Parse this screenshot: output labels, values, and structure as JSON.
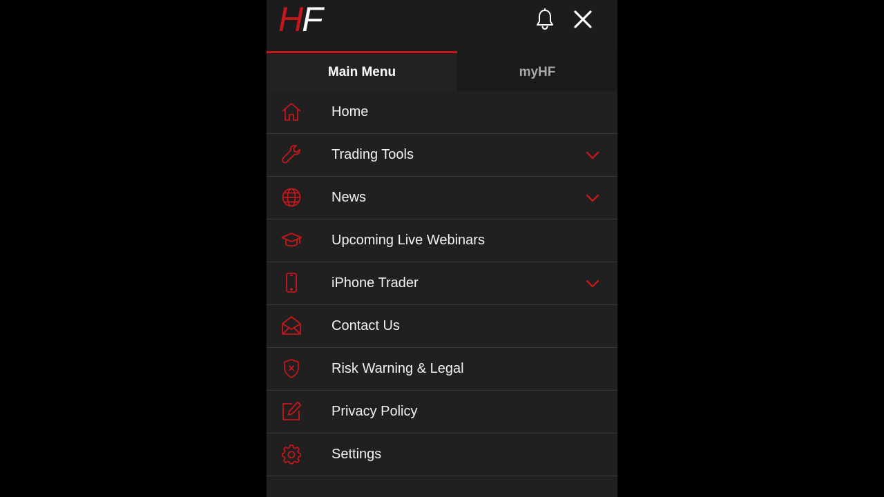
{
  "app": {
    "logo_h": "H",
    "logo_f": "F"
  },
  "header": {
    "icons": [
      "bell-icon",
      "close-icon"
    ]
  },
  "tabs": [
    {
      "label": "Main Menu",
      "active": true
    },
    {
      "label": "myHF",
      "active": false
    }
  ],
  "menu": {
    "items": [
      {
        "label": "Home",
        "icon": "home-icon",
        "expandable": false
      },
      {
        "label": "Trading Tools",
        "icon": "wrench-icon",
        "expandable": true
      },
      {
        "label": "News",
        "icon": "globe-icon",
        "expandable": true
      },
      {
        "label": "Upcoming Live Webinars",
        "icon": "graduation-cap-icon",
        "expandable": false
      },
      {
        "label": "iPhone Trader",
        "icon": "phone-icon",
        "expandable": true
      },
      {
        "label": "Contact Us",
        "icon": "envelope-open-icon",
        "expandable": false
      },
      {
        "label": "Risk Warning & Legal",
        "icon": "shield-x-icon",
        "expandable": false
      },
      {
        "label": "Privacy Policy",
        "icon": "edit-icon",
        "expandable": false
      },
      {
        "label": "Settings",
        "icon": "gear-icon",
        "expandable": false
      }
    ]
  },
  "colors": {
    "accent": "#c8161d",
    "background": "#202020",
    "text": "#f2f2f2"
  }
}
